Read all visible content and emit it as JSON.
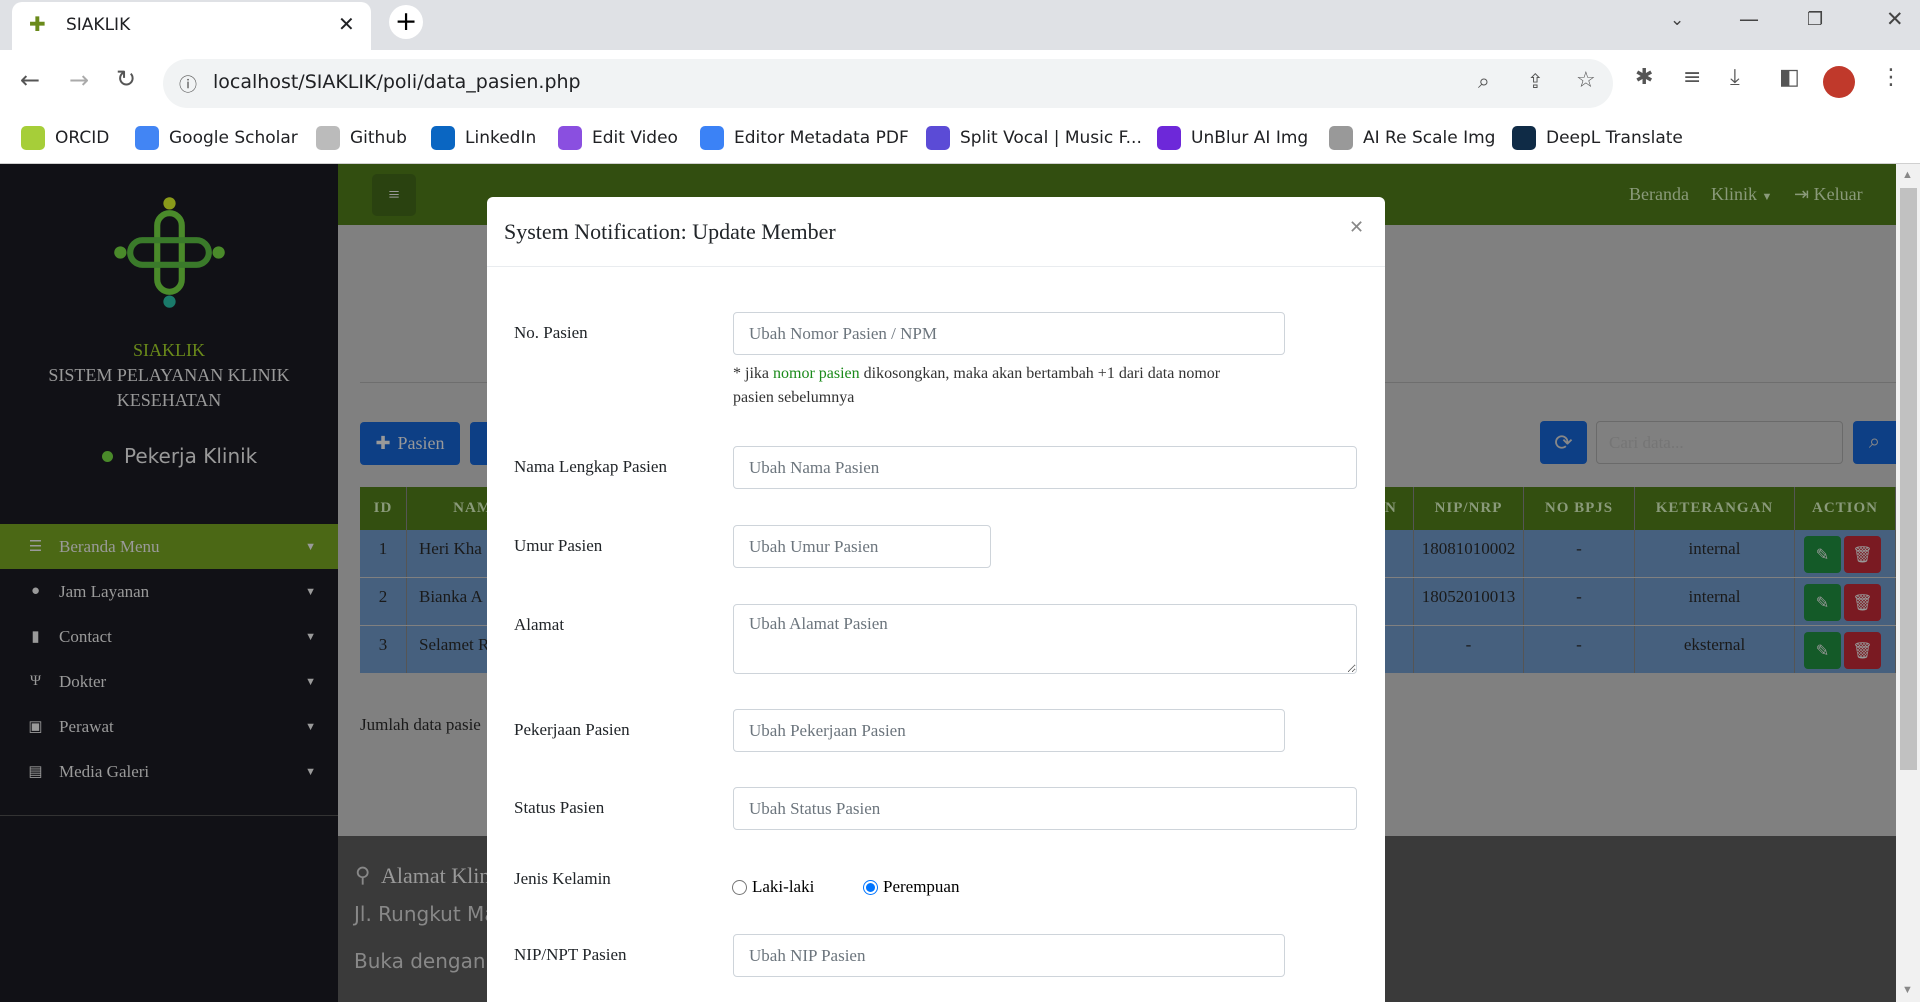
{
  "browser": {
    "tab_title": "SIAKLIK",
    "url": "localhost/SIAKLIK/poli/data_pasien.php",
    "bookmarks": [
      {
        "label": "ORCID",
        "color": "#a6ce39"
      },
      {
        "label": "Google Scholar",
        "color": "#4285f4"
      },
      {
        "label": "Github",
        "color": "#bbbbbb"
      },
      {
        "label": "LinkedIn",
        "color": "#0a66c2"
      },
      {
        "label": "Edit Video",
        "color": "#8a4fe0"
      },
      {
        "label": "Editor Metadata PDF",
        "color": "#3b82f6"
      },
      {
        "label": "Split Vocal | Music F...",
        "color": "#5b4bd6"
      },
      {
        "label": "UnBlur AI Img",
        "color": "#6d28d9"
      },
      {
        "label": "AI Re Scale Img",
        "color": "#999999"
      },
      {
        "label": "DeepL Translate",
        "color": "#0f2b46"
      }
    ]
  },
  "sidebar": {
    "brand": "SIAKLIK",
    "subtitle": "SISTEM PELAYANAN KLINIK KESEHATAN",
    "role": "Pekerja Klinik",
    "items": [
      {
        "label": "Beranda Menu",
        "icon": "list-icon"
      },
      {
        "label": "Jam Layanan",
        "icon": "clock-icon"
      },
      {
        "label": "Contact",
        "icon": "address-book-icon"
      },
      {
        "label": "Dokter",
        "icon": "stethoscope-icon"
      },
      {
        "label": "Perawat",
        "icon": "medkit-icon"
      },
      {
        "label": "Media Galeri",
        "icon": "images-icon"
      }
    ]
  },
  "topnav": {
    "home": "Beranda",
    "klinik": "Klinik",
    "logout": "Keluar"
  },
  "toolbar": {
    "add_label": "Pasien",
    "search_placeholder": "Cari data..."
  },
  "table": {
    "headers": [
      "ID",
      "NAM",
      "N",
      "NIP/NRP",
      "NO BPJS",
      "KETERANGAN",
      "ACTION"
    ],
    "rows": [
      {
        "id": "1",
        "name": "Heri Kha",
        "nip": "18081010002",
        "bpjs": "-",
        "ket": "internal"
      },
      {
        "id": "2",
        "name": "Bianka A",
        "nip": "18052010013",
        "bpjs": "-",
        "ket": "internal"
      },
      {
        "id": "3",
        "name": "Selamet R",
        "nip": "-",
        "bpjs": "-",
        "ket": "eksternal"
      }
    ]
  },
  "count_label": "Jumlah data pasie",
  "footer": {
    "title": "Alamat Klin",
    "address": "Jl. Rungkut Ma",
    "hours": "Buka dengan"
  },
  "modal": {
    "title": "System Notification: Update Member",
    "no_pasien": {
      "label": "No. Pasien",
      "placeholder": "Ubah Nomor Pasien / NPM",
      "help_pre": "* jika ",
      "help_hl": "nomor pasien",
      "help_post": " dikosongkan, maka akan bertambah +1 dari data nomor",
      "help_line2": "pasien sebelumnya"
    },
    "nama": {
      "label": "Nama Lengkap Pasien",
      "placeholder": "Ubah Nama Pasien"
    },
    "umur": {
      "label": "Umur Pasien",
      "placeholder": "Ubah Umur Pasien"
    },
    "alamat": {
      "label": "Alamat",
      "placeholder": "Ubah Alamat Pasien"
    },
    "pekerjaan": {
      "label": "Pekerjaan Pasien",
      "placeholder": "Ubah Pekerjaan Pasien"
    },
    "status": {
      "label": "Status Pasien",
      "placeholder": "Ubah Status Pasien"
    },
    "gender": {
      "label": "Jenis Kelamin",
      "options": [
        "Laki-laki",
        "Perempuan"
      ],
      "selected": "Perempuan"
    },
    "nip": {
      "label": "NIP/NPT Pasien",
      "placeholder": "Ubah NIP Pasien"
    }
  }
}
